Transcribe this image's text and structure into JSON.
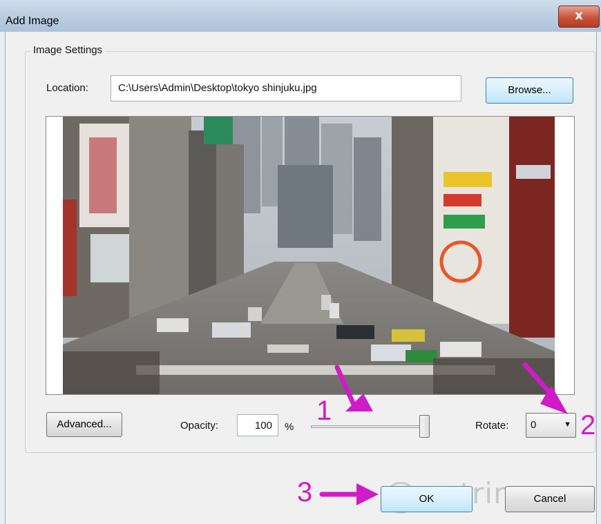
{
  "window": {
    "title": "Add Image",
    "close_glyph": "x"
  },
  "group": {
    "label": "Image Settings"
  },
  "location": {
    "label": "Location:",
    "value": "C:\\Users\\Admin\\Desktop\\tokyo shinjuku.jpg",
    "browse_label": "Browse..."
  },
  "preview": {
    "icon": "image-preview"
  },
  "controls": {
    "advanced_label": "Advanced...",
    "opacity_label": "Opacity:",
    "opacity_value": "100",
    "opacity_unit": "%",
    "opacity_slider_fraction": 1.0,
    "rotate_label": "Rotate:",
    "rotate_value": "0",
    "rotate_arrow": "▼"
  },
  "footer": {
    "ok_label": "OK",
    "cancel_label": "Cancel"
  },
  "annotations": {
    "n1": "1",
    "n2": "2",
    "n3": "3",
    "color": "#d11bc8"
  },
  "watermark": {
    "text": "uantrimang"
  }
}
